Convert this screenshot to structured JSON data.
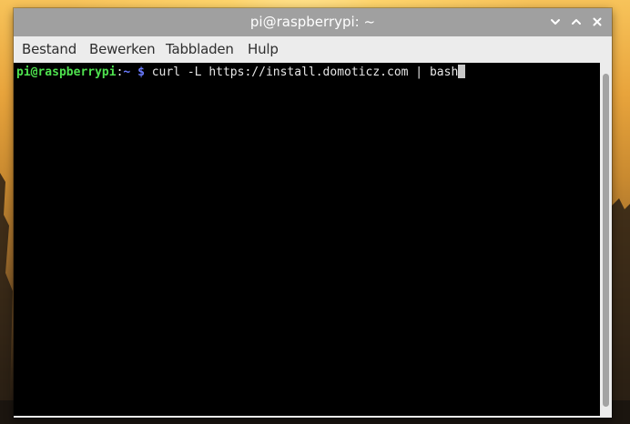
{
  "window": {
    "title": "pi@raspberrypi: ~"
  },
  "menu": {
    "items": [
      {
        "label": "Bestand"
      },
      {
        "label": "Bewerken"
      },
      {
        "label": "Tabbladen"
      },
      {
        "label": "Hulp"
      }
    ]
  },
  "terminal": {
    "prompt_user": "pi@raspberrypi",
    "prompt_separator": ":",
    "prompt_path": "~",
    "prompt_symbol": "$",
    "command": "curl -L https://install.domoticz.com | bash"
  },
  "window_controls": {
    "minimize_icon": "chevron-down-icon",
    "maximize_icon": "chevron-up-icon",
    "close_icon": "close-icon"
  },
  "colors": {
    "titlebar": "#a0a0a0",
    "terminal_bg": "#000000",
    "prompt_user": "#4ee04e",
    "prompt_path": "#6a7bff"
  }
}
